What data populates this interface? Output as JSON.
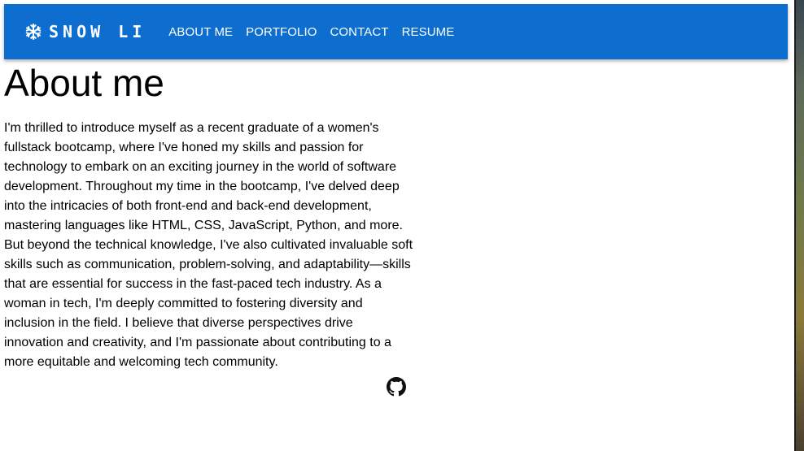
{
  "header": {
    "brand": "SNOW LI",
    "brand_icon": "snowflake-icon",
    "background_color": "#0d6ecf",
    "nav": [
      {
        "label": "ABOUT ME"
      },
      {
        "label": "PORTFOLIO"
      },
      {
        "label": "CONTACT"
      },
      {
        "label": "RESUME"
      }
    ]
  },
  "main": {
    "title": "About me",
    "bio": "I'm thrilled to introduce myself as a recent graduate of a women's fullstack bootcamp, where I've honed my skills and passion for technology to embark on an exciting journey in the world of software development. Throughout my time in the bootcamp, I've delved deep into the intricacies of both front-end and back-end development, mastering languages like HTML, CSS, JavaScript, Python, and more. But beyond the technical knowledge, I've also cultivated invaluable soft skills such as communication, problem-solving, and adaptability—skills that are essential for success in the fast-paced tech industry. As a woman in tech, I'm deeply committed to fostering diversity and inclusion in the field. I believe that diverse perspectives drive innovation and creativity, and I'm passionate about contributing to a more equitable and welcoming tech community.",
    "social_icon": "github-icon"
  }
}
